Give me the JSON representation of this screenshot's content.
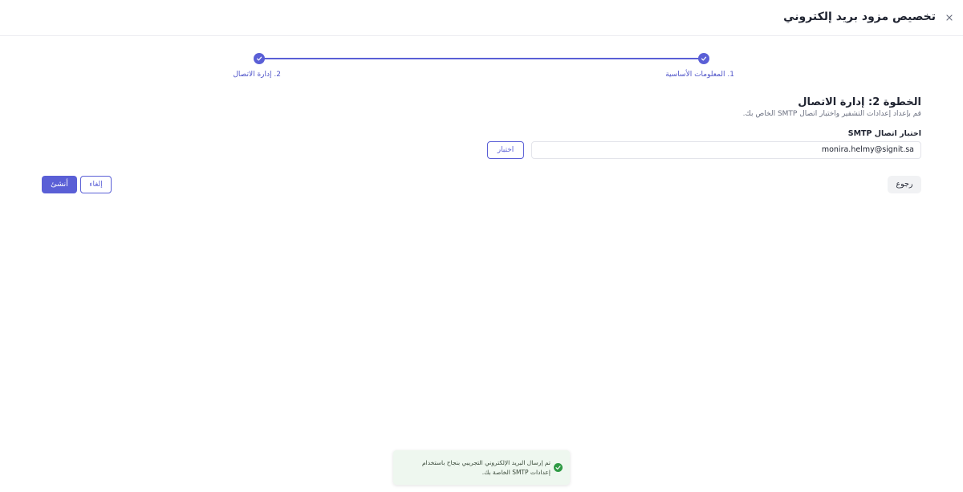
{
  "header": {
    "title": "تخصيص مزود بريد إلكتروني",
    "close_icon": "close-icon"
  },
  "stepper": {
    "steps": [
      {
        "label": "1. المعلومات الأساسية",
        "status": "completed"
      },
      {
        "label": "2. إدارة الاتصال",
        "status": "completed"
      }
    ]
  },
  "main": {
    "heading": "الخطوة 2: إدارة الاتصال",
    "description": "قم بإعداد إعدادات التشفير واختبار اتصال SMTP الخاص بك.",
    "field_label": "اختبار اتصال SMTP",
    "email_value": "monira.helmy@signit.sa",
    "test_button": "اختبار"
  },
  "footer": {
    "back_button": "رجوع",
    "cancel_button": "إلغاء",
    "create_button": "أنشئ"
  },
  "toast": {
    "message": "تم إرسال البريد الإلكتروني التجريبي بنجاح باستخدام إعدادات SMTP الخاصة بك.",
    "icon": "check-circle-icon"
  },
  "colors": {
    "accent": "#5a5fd6",
    "success": "#2e9a44"
  }
}
